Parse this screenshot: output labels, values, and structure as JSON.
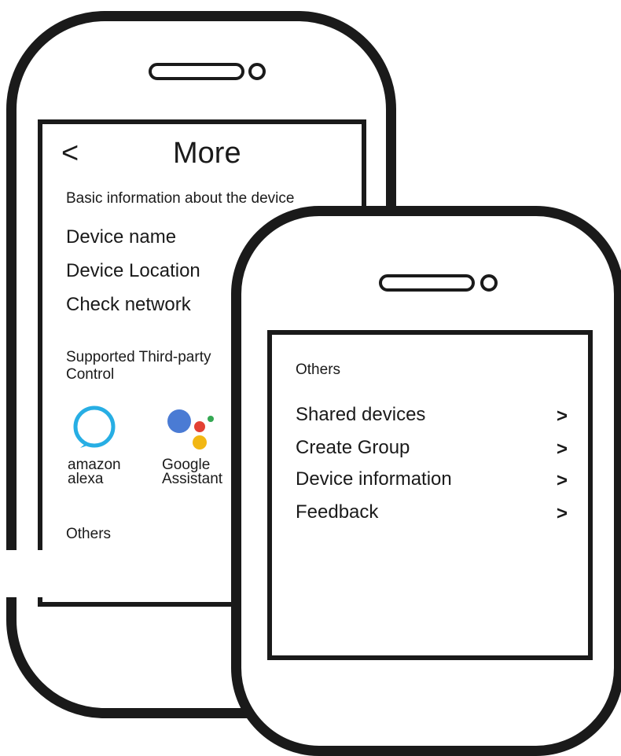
{
  "back_phone": {
    "header": {
      "back_icon": "chevron-left-icon",
      "back_glyph": "<",
      "title": "More"
    },
    "basic_info": {
      "heading": "Basic information about the device",
      "items": [
        {
          "label": "Device name"
        },
        {
          "label": "Device Location"
        },
        {
          "label": "Check network"
        }
      ]
    },
    "third_party": {
      "heading_line1": "Supported Third-party",
      "heading_line2": "Control",
      "integrations": [
        {
          "icon": "amazon-alexa-icon",
          "line1": "amazon",
          "line2": "alexa",
          "color": "#27aee4"
        },
        {
          "icon": "google-assistant-icon",
          "line1": "Google",
          "line2": "Assistant",
          "colors": {
            "blue": "#4a7bd4",
            "red": "#e34133",
            "yellow": "#f2b713",
            "green": "#34a853"
          }
        }
      ]
    },
    "others_heading": "Others"
  },
  "front_phone": {
    "others_heading": "Others",
    "chevron_glyph": ">",
    "items": [
      {
        "label": "Shared devices"
      },
      {
        "label": "Create Group"
      },
      {
        "label": "Device information"
      },
      {
        "label": "Feedback"
      }
    ]
  }
}
